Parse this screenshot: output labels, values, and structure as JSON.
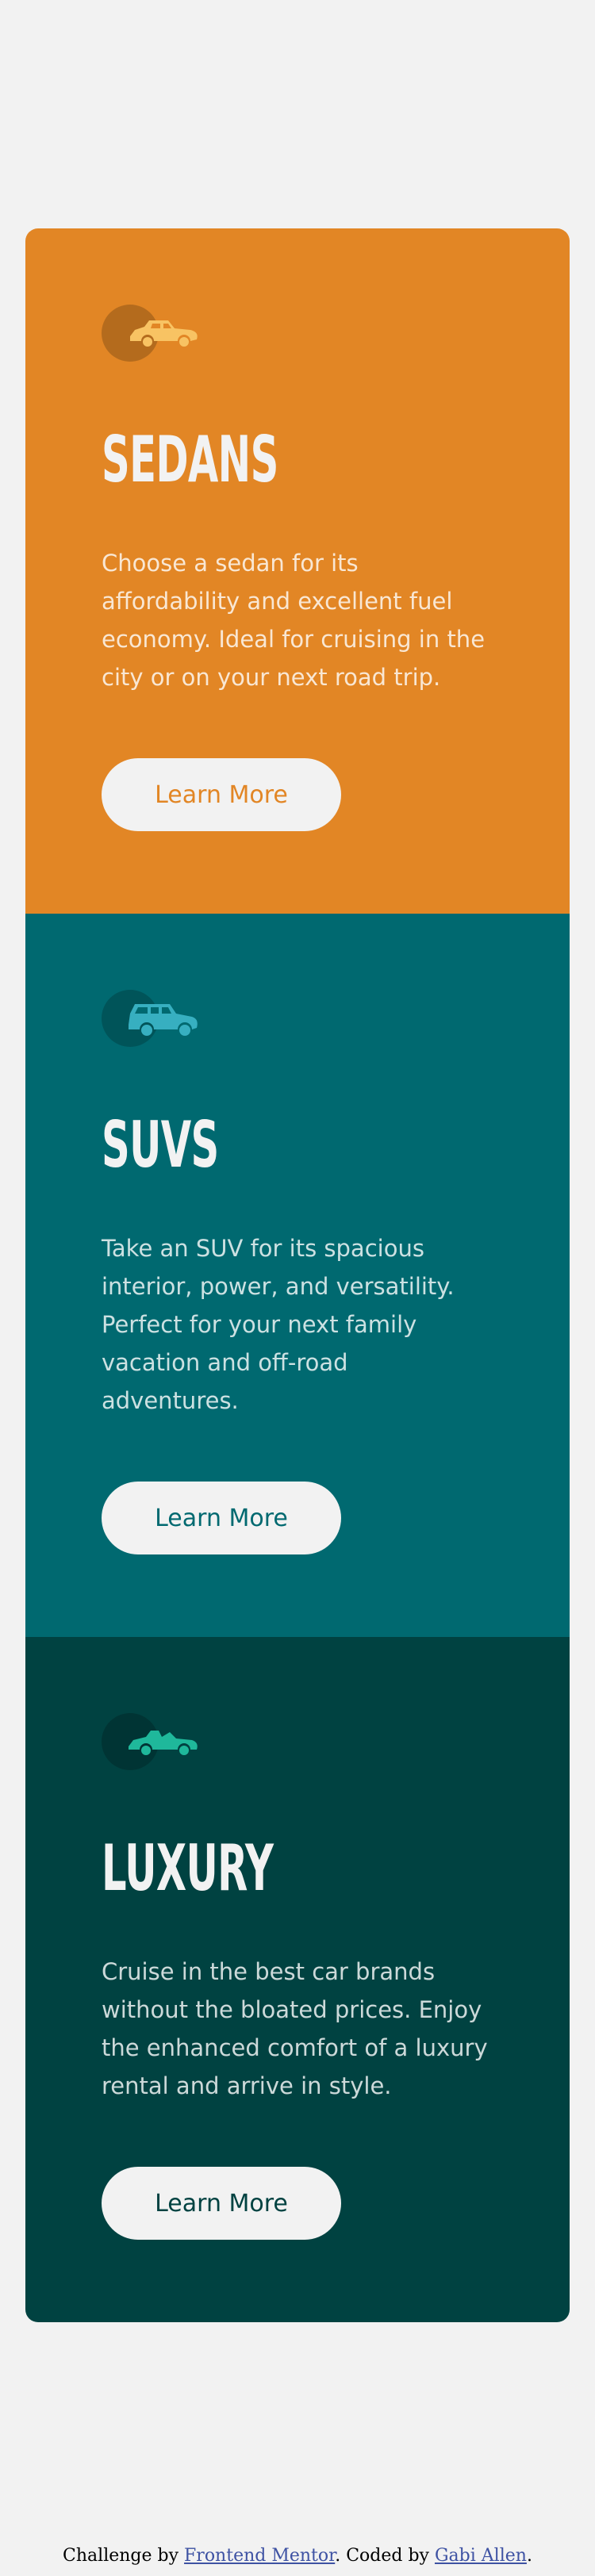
{
  "cards": [
    {
      "id": "sedans",
      "icon": "sedan-car-icon",
      "icon_color": "#f8c363",
      "title": "SEDANS",
      "description": "Choose a sedan for its affordability and excellent fuel economy. Ideal for cruising in the city or on your next road trip.",
      "button_label": "Learn More",
      "background": "#e28625"
    },
    {
      "id": "suvs",
      "icon": "suv-car-icon",
      "icon_color": "#37afc0",
      "title": "SUVS",
      "description": "Take an SUV for its spacious interior, power, and versatility. Perfect for your next family vacation and off-road adventures.",
      "button_label": "Learn More",
      "background": "#006970"
    },
    {
      "id": "luxury",
      "icon": "luxury-car-icon",
      "icon_color": "#1fb89b",
      "title": "LUXURY",
      "description": "Cruise in the best car brands without the bloated prices. Enjoy the enhanced comfort of a luxury rental and arrive in style.",
      "button_label": "Learn More",
      "background": "#004241"
    }
  ],
  "attribution": {
    "prefix": "Challenge by ",
    "link1": "Frontend Mentor",
    "middle": ". Coded by ",
    "link2": "Gabi Allen",
    "suffix": "."
  }
}
